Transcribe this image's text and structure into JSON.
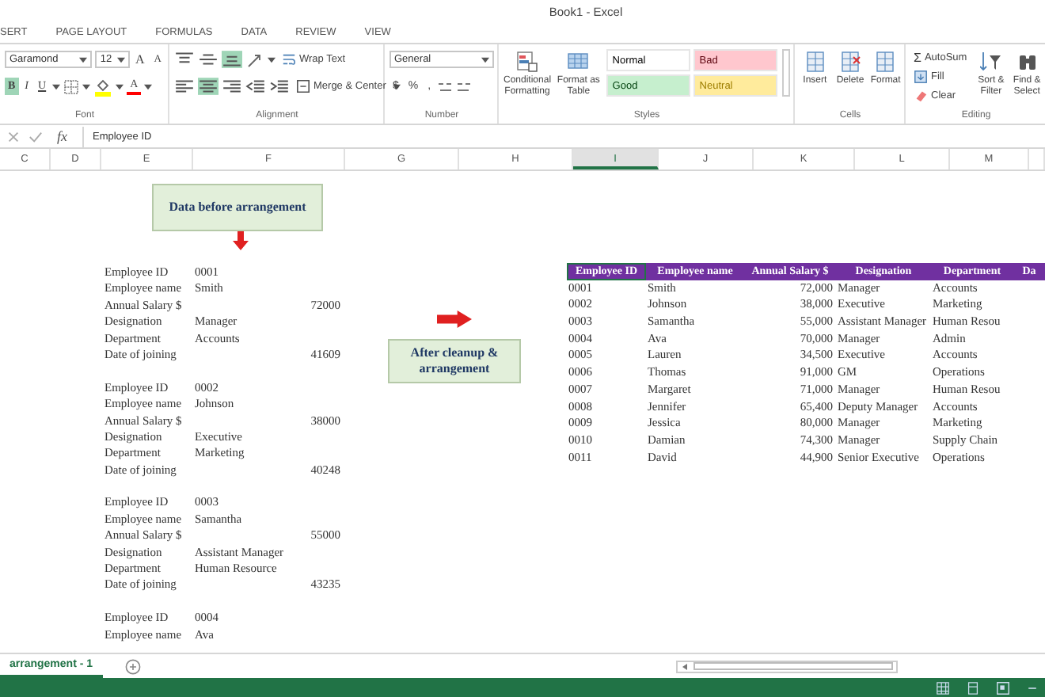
{
  "window": {
    "title": "Book1 - Excel"
  },
  "ribbon_tabs": [
    "SERT",
    "PAGE LAYOUT",
    "FORMULAS",
    "DATA",
    "REVIEW",
    "VIEW"
  ],
  "font": {
    "name": "Garamond",
    "size": "12",
    "grow": [
      "A",
      "A"
    ],
    "toggles": [
      {
        "kind": "bold",
        "label": "B",
        "on": true
      },
      {
        "kind": "italic",
        "label": "I",
        "on": false
      },
      {
        "kind": "underline",
        "label": "U",
        "on": false
      }
    ],
    "fill": {
      "color": "#ffff00"
    },
    "font_color": {
      "label": "A",
      "color": "#ff0000"
    },
    "label": "Font"
  },
  "alignment": {
    "top_row": [
      {
        "kind": "top",
        "on": false
      },
      {
        "kind": "middle",
        "on": false
      },
      {
        "kind": "bottom",
        "on": true
      }
    ],
    "bottom_row": [
      {
        "kind": "left",
        "on": false
      },
      {
        "kind": "center",
        "on": true
      },
      {
        "kind": "right",
        "on": false
      },
      {
        "kind": "outdent",
        "on": false
      },
      {
        "kind": "indent",
        "on": false
      }
    ],
    "wrap": "Wrap Text",
    "merge": "Merge & Center",
    "label": "Alignment"
  },
  "number": {
    "format": "General",
    "symbols": [
      "$",
      "%",
      ","
    ],
    "label": "Number"
  },
  "styles": {
    "buttons": [
      "Conditional Formatting",
      "Format as Table"
    ],
    "cells": [
      {
        "label": "Normal",
        "color": "#ffffff"
      },
      {
        "label": "Bad",
        "color": "#ffc7ce"
      },
      {
        "label": "Good",
        "color": "#c6efce"
      },
      {
        "label": "Neutral",
        "color": "#ffeb9c"
      }
    ],
    "label": "Styles"
  },
  "cells": {
    "buttons": [
      "Insert",
      "Delete",
      "Format"
    ],
    "label": "Cells"
  },
  "editing": {
    "sum": "Σ",
    "autosum": "AutoSum",
    "fill": "Fill",
    "clear": "Clear",
    "sort": "Sort & Filter",
    "find": [
      "Find &",
      "Select"
    ],
    "label": "Editing"
  },
  "formula_bar": {
    "fx": "fx",
    "formula": "Employee ID"
  },
  "columns": [
    {
      "label": "C",
      "selected": false
    },
    {
      "label": "D",
      "selected": false
    },
    {
      "label": "E",
      "selected": false
    },
    {
      "label": "F",
      "selected": false
    },
    {
      "label": "G",
      "selected": false
    },
    {
      "label": "H",
      "selected": false
    },
    {
      "label": "I",
      "selected": true
    },
    {
      "label": "J",
      "selected": false
    },
    {
      "label": "K",
      "selected": false
    },
    {
      "label": "L",
      "selected": false
    },
    {
      "label": "M",
      "selected": false
    }
  ],
  "callouts": [
    "Data before arrangement",
    "After cleanup & arrangement"
  ],
  "records": [
    {
      "fields": [
        {
          "label": "Employee ID",
          "value": "0001",
          "kind": "text"
        },
        {
          "label": "Employee name",
          "value": "Smith",
          "kind": "text"
        },
        {
          "label": "Annual Salary $",
          "value": "72000",
          "kind": "number"
        },
        {
          "label": "Designation",
          "value": "Manager",
          "kind": "text"
        },
        {
          "label": "Department",
          "value": "Accounts",
          "kind": "text"
        },
        {
          "label": "Date of joining",
          "value": "41609",
          "kind": "number"
        }
      ]
    },
    {
      "fields": [
        {
          "label": "Employee ID",
          "value": "0002",
          "kind": "text"
        },
        {
          "label": "Employee name",
          "value": "Johnson",
          "kind": "text"
        },
        {
          "label": "Annual Salary $",
          "value": "38000",
          "kind": "number"
        },
        {
          "label": "Designation",
          "value": "Executive",
          "kind": "text"
        },
        {
          "label": "Department",
          "value": "Marketing",
          "kind": "text"
        },
        {
          "label": "Date of joining",
          "value": "40248",
          "kind": "number"
        }
      ]
    },
    {
      "fields": [
        {
          "label": "Employee ID",
          "value": "0003",
          "kind": "text"
        },
        {
          "label": "Employee name",
          "value": "Samantha",
          "kind": "text"
        },
        {
          "label": "Annual Salary $",
          "value": "55000",
          "kind": "number"
        },
        {
          "label": "Designation",
          "value": "Assistant Manager",
          "kind": "text"
        },
        {
          "label": "Department",
          "value": "Human Resource",
          "kind": "text"
        },
        {
          "label": "Date of joining",
          "value": "43235",
          "kind": "number"
        }
      ]
    },
    {
      "fields": [
        {
          "label": "Employee ID",
          "value": "0004",
          "kind": "text"
        },
        {
          "label": "Employee name",
          "value": "Ava",
          "kind": "text"
        }
      ]
    }
  ],
  "table": {
    "header": [
      {
        "label": "Employee ID",
        "selected": true
      },
      {
        "label": "Employee name",
        "selected": false
      },
      {
        "label": "Annual Salary $",
        "selected": false
      },
      {
        "label": "Designation",
        "selected": false
      },
      {
        "label": "Department",
        "selected": false
      },
      {
        "label": "Da",
        "selected": false
      }
    ],
    "rows": [
      [
        "0001",
        "Smith",
        "72,000",
        "Manager",
        "Accounts"
      ],
      [
        "0002",
        "Johnson",
        "38,000",
        "Executive",
        "Marketing"
      ],
      [
        "0003",
        "Samantha",
        "55,000",
        "Assistant Manager",
        "Human Resou"
      ],
      [
        "0004",
        "Ava",
        "70,000",
        "Manager",
        "Admin"
      ],
      [
        "0005",
        "Lauren",
        "34,500",
        "Executive",
        "Accounts"
      ],
      [
        "0006",
        "Thomas",
        "91,000",
        "GM",
        "Operations"
      ],
      [
        "0007",
        "Margaret",
        "71,000",
        "Manager",
        "Human Resou"
      ],
      [
        "0008",
        "Jennifer",
        "65,400",
        "Deputy Manager",
        "Accounts"
      ],
      [
        "0009",
        "Jessica",
        "80,000",
        "Manager",
        "Marketing"
      ],
      [
        "0010",
        "Damian",
        "74,300",
        "Manager",
        "Supply Chain"
      ],
      [
        "0011",
        "David",
        "44,900",
        "Senior Executive",
        "Operations"
      ]
    ]
  },
  "sheet_tabs": [
    {
      "label": "arrangement - 1",
      "selected": true
    }
  ]
}
